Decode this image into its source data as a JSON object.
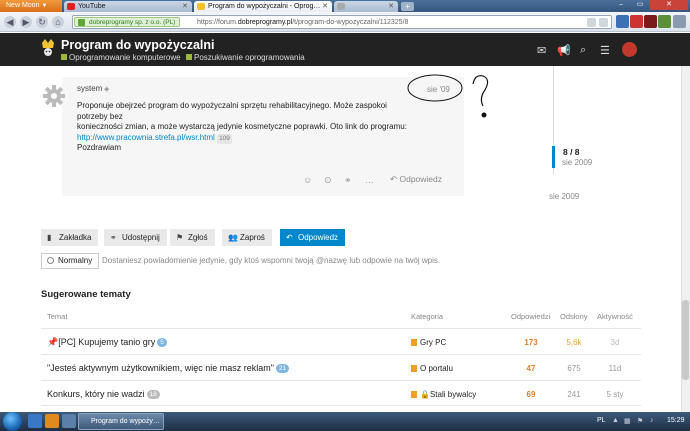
{
  "browser": {
    "app_menu": "New Moon",
    "tabs": [
      {
        "label": "YouTube",
        "state": "inactive"
      },
      {
        "label": "Program do wypożyczalni - Oprog…",
        "state": "active"
      },
      {
        "label": "",
        "state": "inactive"
      }
    ],
    "new_tab": "+",
    "site_identity": "dobreprogramy sp. z o.o. (PL)",
    "url_prefix": "https://forum.",
    "url_domain": "dobreprogramy.pl",
    "url_path": "/t/program-do-wypozyczalni/112325/8",
    "window_controls": [
      "–",
      "▭",
      "✕"
    ]
  },
  "forum": {
    "title": "Program do wypożyczalni",
    "breadcrumbs": [
      {
        "label": "Oprogramowanie komputerowe",
        "color": "#9eb83b"
      },
      {
        "label": "Poszukiwanie oprogramowania",
        "color": "#9eb83b"
      }
    ]
  },
  "post": {
    "username": "system",
    "date": "sie '09",
    "body_line1": "Proponuje obejrzeć program do wypożyczalni sprzętu rehabilitacyjnego. Może zaspokoi potrzeby bez",
    "body_line2": "konieczności zmian, a może wystarczą jedynie kosmetyczne poprawki. Oto link do programu:",
    "link": "http://www.pracownia.strefa.pl/wsr.html",
    "link_clicks": "109",
    "greeting": "Pozdrawiam",
    "reply_label": "Odpowiedz"
  },
  "annotation": {
    "mark": "?"
  },
  "timeline": {
    "count": "8 / 8",
    "date_current": "sie 2009",
    "date_end": "sie 2009"
  },
  "actions": {
    "bookmark": "Zakładka",
    "share": "Udostępnij",
    "flag": "Zgłoś",
    "invite": "Zaproś",
    "reply": "Odpowiedz"
  },
  "notifications": {
    "level": "Normalny",
    "description": "Dostaniesz powiadomienie jedynie, gdy ktoś wspomni twoją @nazwę lub odpowie na twój wpis."
  },
  "suggested": {
    "title": "Sugerowane tematy",
    "headers": {
      "topic": "Temat",
      "category": "Kategoria",
      "replies": "Odpowiedzi",
      "views": "Odsłony",
      "activity": "Aktywność"
    },
    "rows": [
      {
        "pinned": true,
        "title": "[PC] Kupujemy tanio gry",
        "badge": "5",
        "category": "Gry PC",
        "cat_color": "#f0a020",
        "locked": false,
        "replies": "173",
        "views": "5,6k",
        "activity": "3d",
        "views_color": "#e8a030"
      },
      {
        "pinned": false,
        "title": "\"Jesteś aktywnym użytkownikiem, więc nie masz reklam\"",
        "badge": "21",
        "category": "O portalu",
        "cat_color": "#f0a020",
        "locked": false,
        "replies": "47",
        "views": "675",
        "activity": "11d",
        "views_color": "#999999"
      },
      {
        "pinned": false,
        "title": "Konkurs, który nie wadzi",
        "badge": "18",
        "category": "Stali bywalcy",
        "cat_color": "#f0a020",
        "locked": true,
        "replies": "69",
        "views": "241",
        "activity": "5 sty",
        "views_color": "#999999"
      }
    ]
  },
  "taskbar": {
    "window": "Program do wypoży…",
    "lang": "PL",
    "clock": "15:29"
  }
}
